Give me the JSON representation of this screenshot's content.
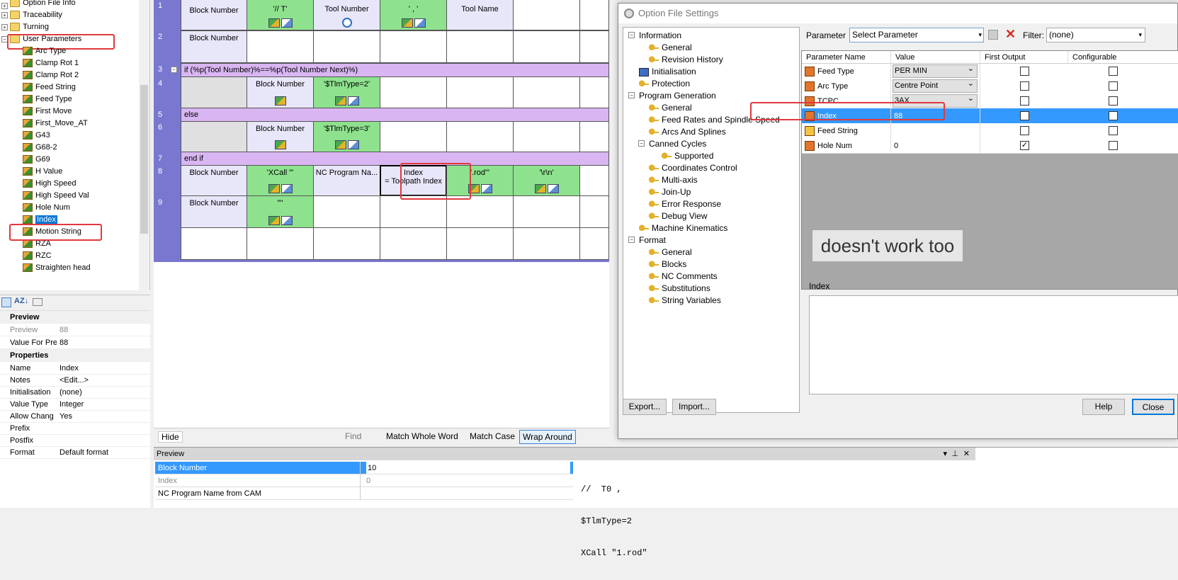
{
  "left_tree": {
    "top_items": [
      {
        "label": "Option File Info"
      },
      {
        "label": "Traceability"
      },
      {
        "label": "Turning"
      },
      {
        "label": "User Parameters"
      }
    ],
    "params": [
      "Arc Type",
      "Clamp Rot 1",
      "Clamp Rot 2",
      "Feed String",
      "Feed Type",
      "First Move",
      "First_Move_AT",
      "G43",
      "G68-2",
      "G69",
      "H Value",
      "High Speed",
      "High Speed Val",
      "Hole Num",
      "Index",
      "Motion String",
      "RZA",
      "RZC",
      "Straighten head"
    ]
  },
  "props": {
    "preview_cat": "Preview",
    "rows1": [
      {
        "k": "Preview",
        "v": "88"
      },
      {
        "k": "Value For Pre",
        "v": "88"
      }
    ],
    "properties_cat": "Properties",
    "rows2": [
      {
        "k": "Name",
        "v": "Index"
      },
      {
        "k": "Notes",
        "v": "<Edit...>"
      },
      {
        "k": "Initialisation",
        "v": "(none)"
      },
      {
        "k": "Value Type",
        "v": "Integer"
      },
      {
        "k": "Allow Chang",
        "v": "Yes"
      },
      {
        "k": "Prefix",
        "v": ""
      },
      {
        "k": "Postfix",
        "v": ""
      },
      {
        "k": "Format",
        "v": "Default format"
      }
    ]
  },
  "grid": {
    "r1": {
      "num": "1",
      "c1": "Block Number",
      "c2": "'// T'",
      "c3": "Tool Number",
      "c4": "' , '",
      "c5": "Tool Name"
    },
    "r2": {
      "num": "2",
      "c1": "Block Number"
    },
    "r3": {
      "num": "3",
      "text": "if  (%p(Tool Number)%==%p(Tool Number Next)%)"
    },
    "r4": {
      "num": "4",
      "c2": "Block Number",
      "c3": "'$TlmType=2'"
    },
    "r5": {
      "num": "5",
      "text": "else"
    },
    "r6": {
      "num": "6",
      "c2": "Block Number",
      "c3": "'$TlmType=3'"
    },
    "r7": {
      "num": "7",
      "text": "end if"
    },
    "r8": {
      "num": "8",
      "c1": "Block Number",
      "c2": "'XCall \"'",
      "c3": "NC Program Na...",
      "c4a": "Index",
      "c4b": "= Toolpath Index",
      "c5": "'.rod\"'",
      "c6": "'\\r\\n'"
    },
    "r9": {
      "num": "9",
      "c1": "Block Number",
      "c2": "'\"'"
    }
  },
  "findbar": {
    "hide": "Hide",
    "find": "Find",
    "match_whole": "Match Whole Word",
    "match_case": "Match Case",
    "wrap": "Wrap Around"
  },
  "preview": {
    "title": "Preview",
    "rows": [
      {
        "k": "Block Number",
        "v": "10"
      },
      {
        "k": "Index",
        "v": "0"
      },
      {
        "k": "NC Program Name from CAM",
        "v": ""
      }
    ],
    "code": [
      "//  T0 ,",
      "$TlmType=2",
      "XCall \"1.rod\""
    ]
  },
  "dialog": {
    "title": "Option File Settings",
    "nav": [
      {
        "label": "Information"
      },
      {
        "label": "General"
      },
      {
        "label": "Revision History"
      },
      {
        "label": "Initialisation"
      },
      {
        "label": "Protection"
      },
      {
        "label": "Program Generation"
      },
      {
        "label": "General"
      },
      {
        "label": "Feed Rates and Spindle Speed"
      },
      {
        "label": "Arcs And Splines"
      },
      {
        "label": "Canned Cycles"
      },
      {
        "label": "Supported"
      },
      {
        "label": "Coordinates Control"
      },
      {
        "label": "Multi-axis"
      },
      {
        "label": "Join-Up"
      },
      {
        "label": "Error Response"
      },
      {
        "label": "Debug View"
      },
      {
        "label": "Machine Kinematics"
      },
      {
        "label": "Format"
      },
      {
        "label": "General"
      },
      {
        "label": "Blocks"
      },
      {
        "label": "NC Comments"
      },
      {
        "label": "Substitutions"
      },
      {
        "label": "String Variables"
      }
    ],
    "param_label": "Parameter",
    "param_value": "Select Parameter",
    "filter_label": "Filter:",
    "filter_value": "(none)",
    "columns": [
      "Parameter Name",
      "Value",
      "First Output",
      "Configurable"
    ],
    "rows": [
      {
        "name": "Feed Type",
        "value": "PER MIN",
        "first": false,
        "conf": false,
        "dropdown": true
      },
      {
        "name": "Arc Type",
        "value": "Centre Point",
        "first": false,
        "conf": false,
        "dropdown": true
      },
      {
        "name": "TCPC",
        "value": "3AX",
        "first": false,
        "conf": false,
        "dropdown": true
      },
      {
        "name": "Index",
        "value": "88",
        "first": false,
        "conf": false,
        "dropdown": false
      },
      {
        "name": "Feed String",
        "value": "",
        "first": false,
        "conf": false,
        "dropdown": false
      },
      {
        "name": "Hole Num",
        "value": "0",
        "first": true,
        "conf": false,
        "dropdown": false
      }
    ],
    "annotation": "doesn't work too",
    "desc_label": "Index",
    "export": "Export...",
    "import": "Import...",
    "help": "Help",
    "close": "Close"
  }
}
